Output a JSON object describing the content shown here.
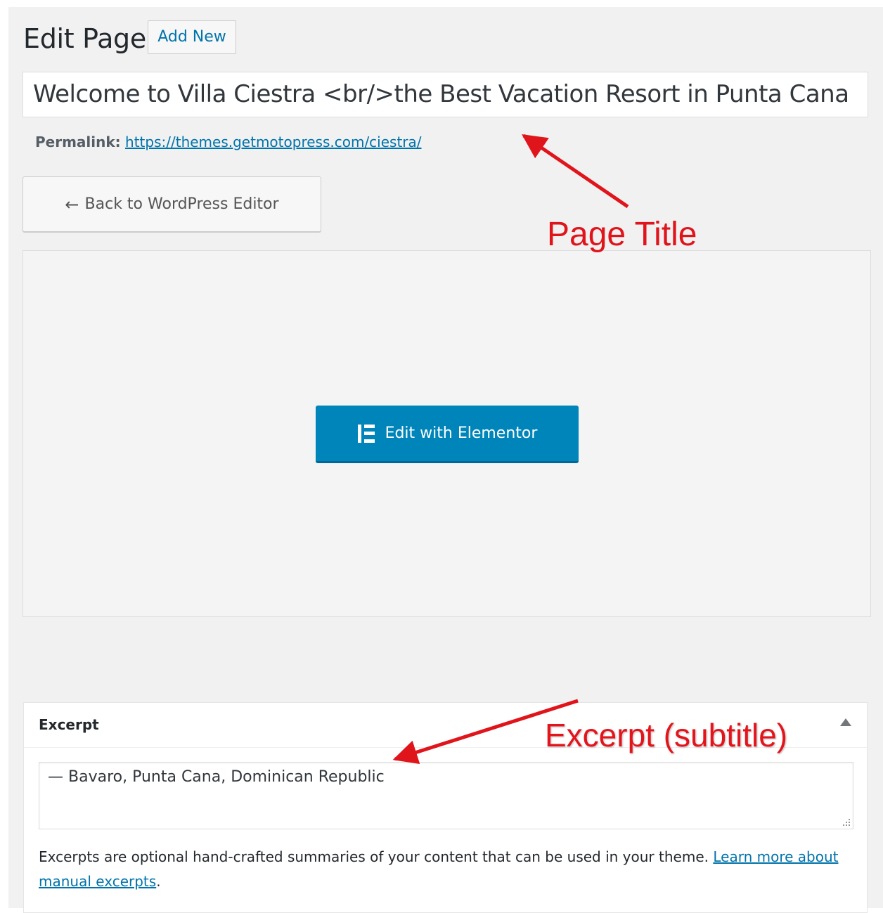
{
  "header": {
    "title": "Edit Page",
    "add_new_label": "Add New"
  },
  "post_title": {
    "value": "Welcome to Villa Ciestra <br/>the Best Vacation Resort in Punta Cana"
  },
  "permalink": {
    "label": "Permalink:",
    "url": "https://themes.getmotopress.com/ciestra/"
  },
  "editor": {
    "back_label": "Back to WordPress Editor",
    "elementor_label": "Edit with Elementor"
  },
  "excerpt": {
    "title": "Excerpt",
    "value": "— Bavaro, Punta Cana, Dominican Republic",
    "help_text": "Excerpts are optional hand-crafted summaries of your content that can be used in your theme.",
    "help_link": "Learn more about manual excerpts",
    "help_end": "."
  },
  "annotations": {
    "page_title": "Page Title",
    "excerpt_subtitle": "Excerpt (subtitle)"
  },
  "icons": {
    "back": "arrow-left-icon",
    "elementor": "elementor-icon",
    "toggle": "triangle-up-icon",
    "resize": "resize-handle-icon"
  },
  "colors": {
    "background": "#f1f1f1",
    "link": "#0073aa",
    "elementor_button": "#0085ba",
    "annotation": "#e0141b"
  }
}
